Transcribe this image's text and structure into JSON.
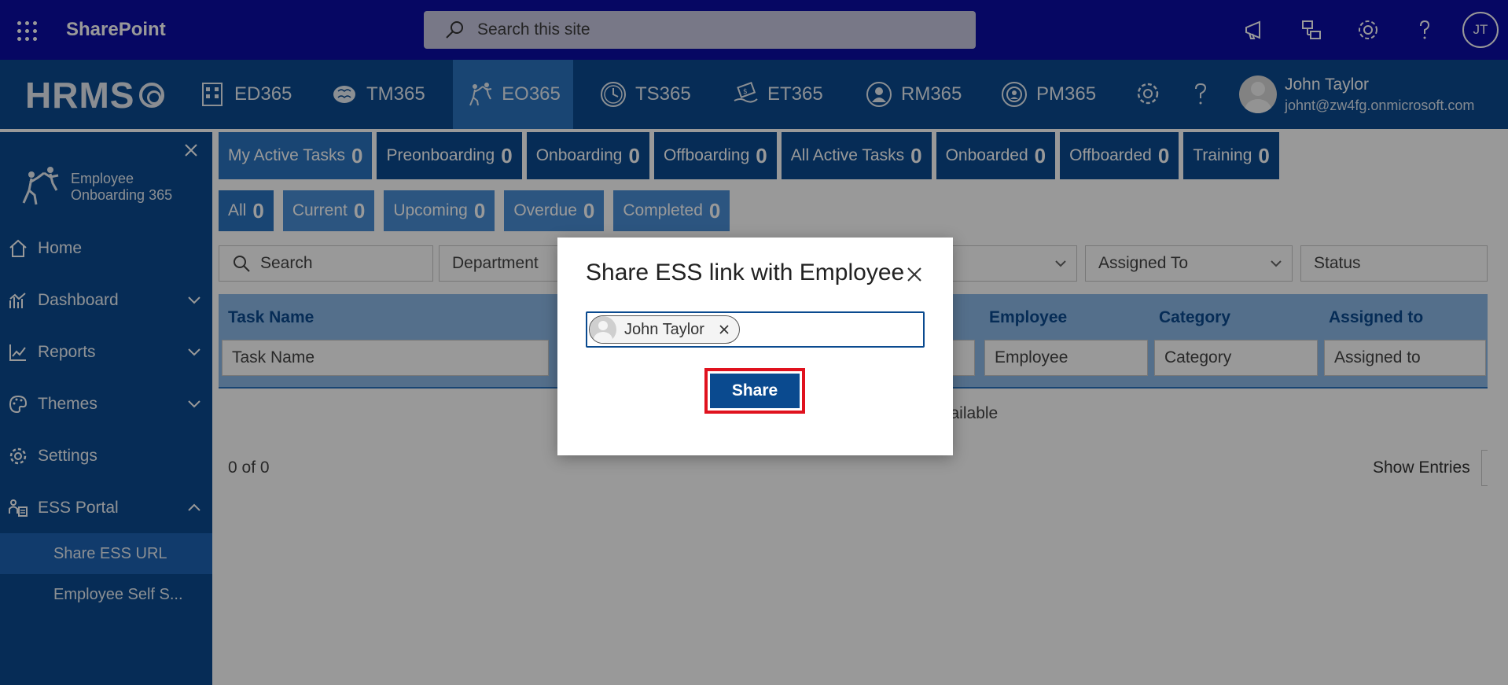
{
  "suite_bar": {
    "app_name": "SharePoint",
    "search_placeholder": "Search this site",
    "user_initials": "JT"
  },
  "app_bar": {
    "logo_text": "HRMS",
    "modules": [
      {
        "label": "ED365",
        "icon": "building-icon"
      },
      {
        "label": "TM365",
        "icon": "brain-icon"
      },
      {
        "label": "EO365",
        "icon": "onboarding-icon",
        "active": true
      },
      {
        "label": "TS365",
        "icon": "clock-icon"
      },
      {
        "label": "ET365",
        "icon": "money-icon"
      },
      {
        "label": "RM365",
        "icon": "recruit-icon"
      },
      {
        "label": "PM365",
        "icon": "performance-icon"
      }
    ],
    "user_name": "John Taylor",
    "user_email": "johnt@zw4fg.onmicrosoft.com"
  },
  "sidebar": {
    "logo_text": "Employee\nOnboarding 365",
    "items": [
      {
        "label": "Home",
        "icon": "home-icon"
      },
      {
        "label": "Dashboard",
        "icon": "dashboard-icon"
      },
      {
        "label": "Reports",
        "icon": "reports-icon"
      },
      {
        "label": "Themes",
        "icon": "palette-icon"
      },
      {
        "label": "Settings",
        "icon": "gear-icon"
      },
      {
        "label": "ESS Portal",
        "icon": "ess-icon"
      }
    ],
    "sub_items": [
      {
        "label": "Share ESS URL",
        "active": true
      },
      {
        "label": "Employee Self S..."
      }
    ]
  },
  "main": {
    "tabs": [
      {
        "label": "My Active Tasks",
        "count": "0"
      },
      {
        "label": "Preonboarding",
        "count": "0"
      },
      {
        "label": "Onboarding",
        "count": "0"
      },
      {
        "label": "Offboarding",
        "count": "0"
      },
      {
        "label": "All Active Tasks",
        "count": "0"
      },
      {
        "label": "Onboarded",
        "count": "0"
      },
      {
        "label": "Offboarded",
        "count": "0"
      },
      {
        "label": "Training",
        "count": "0"
      }
    ],
    "subtabs": [
      {
        "label": "All",
        "count": "0"
      },
      {
        "label": "Current",
        "count": "0"
      },
      {
        "label": "Upcoming",
        "count": "0"
      },
      {
        "label": "Overdue",
        "count": "0"
      },
      {
        "label": "Completed",
        "count": "0"
      }
    ],
    "filters": {
      "search": "Search",
      "department": "Department",
      "assigned_to": "Assigned To",
      "status": "Status"
    },
    "columns": {
      "task_name": "Task Name",
      "employee": "Employee",
      "category": "Category",
      "assigned_to": "Assigned to"
    },
    "column_filters": {
      "task_name": "Task Name",
      "employee": "Employee",
      "category": "Category",
      "assigned_to": "Assigned to"
    },
    "empty_text_fragment": "vailable",
    "paging": "0 of 0",
    "show_entries": "Show Entries"
  },
  "dialog": {
    "title": "Share ESS link with Employee",
    "selected_person": "John Taylor",
    "share_label": "Share"
  },
  "colors": {
    "suite_bar": "#0b0ca5",
    "app_bar": "#0a4a8f",
    "active_tab": "#2b74c0",
    "highlight_border": "#e0121e"
  }
}
